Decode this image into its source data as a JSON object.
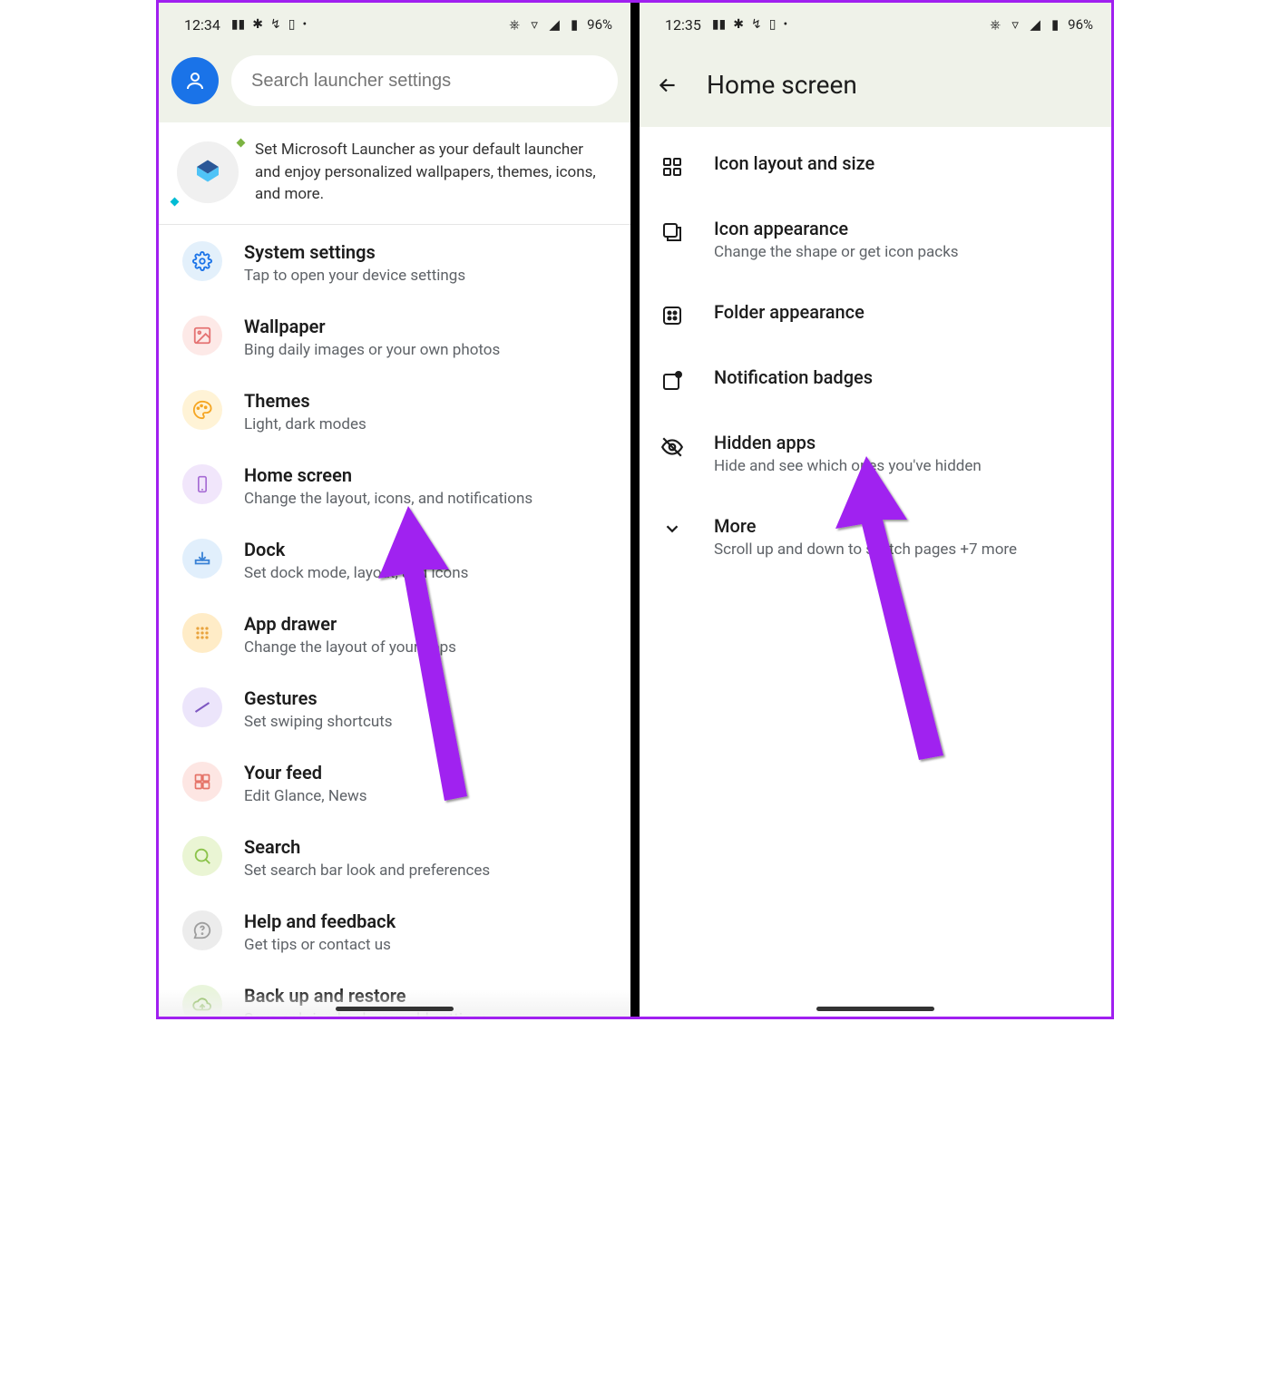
{
  "left": {
    "status": {
      "time": "12:34",
      "battery": "96%"
    },
    "search_placeholder": "Search launcher settings",
    "promo": "Set Microsoft Launcher as your default launcher and enjoy personalized wallpapers, themes, icons, and more.",
    "items": [
      {
        "icon": "gear",
        "bg": "#e3f0fb",
        "fg": "#1a73e8",
        "title": "System settings",
        "sub": "Tap to open your device settings"
      },
      {
        "icon": "image",
        "bg": "#fde9e7",
        "fg": "#e57373",
        "title": "Wallpaper",
        "sub": "Bing daily images or your own photos"
      },
      {
        "icon": "palette",
        "bg": "#fff3d6",
        "fg": "#f5a623",
        "title": "Themes",
        "sub": "Light, dark modes"
      },
      {
        "icon": "phone",
        "bg": "#f1e6fb",
        "fg": "#a66bd4",
        "title": "Home screen",
        "sub": "Change the layout, icons, and notifications"
      },
      {
        "icon": "dock",
        "bg": "#e1effc",
        "fg": "#3a82d6",
        "title": "Dock",
        "sub": "Set dock mode, layout, and icons"
      },
      {
        "icon": "grid",
        "bg": "#ffecc7",
        "fg": "#e8a33d",
        "title": "App drawer",
        "sub": "Change the layout of your apps"
      },
      {
        "icon": "gesture",
        "bg": "#ece5fb",
        "fg": "#7e57c2",
        "title": "Gestures",
        "sub": "Set swiping shortcuts"
      },
      {
        "icon": "feed",
        "bg": "#fde6e3",
        "fg": "#e57368",
        "title": "Your feed",
        "sub": "Edit Glance, News"
      },
      {
        "icon": "search",
        "bg": "#eaf5d4",
        "fg": "#8bc34a",
        "title": "Search",
        "sub": "Set search bar look and preferences"
      },
      {
        "icon": "help",
        "bg": "#ececec",
        "fg": "#9e9e9e",
        "title": "Help and feedback",
        "sub": "Get tips or contact us"
      },
      {
        "icon": "cloud",
        "bg": "#e9f5dc",
        "fg": "#7cb342",
        "title": "Back up and restore",
        "sub": "Save or bring back your old settings"
      }
    ]
  },
  "right": {
    "status": {
      "time": "12:35",
      "battery": "96%"
    },
    "page_title": "Home screen",
    "items": [
      {
        "icon": "layout",
        "title": "Icon layout and size",
        "sub": ""
      },
      {
        "icon": "shape",
        "title": "Icon appearance",
        "sub": "Change the shape or get icon packs"
      },
      {
        "icon": "folder",
        "title": "Folder appearance",
        "sub": ""
      },
      {
        "icon": "badge",
        "title": "Notification badges",
        "sub": ""
      },
      {
        "icon": "hidden",
        "title": "Hidden apps",
        "sub": "Hide and see which ones you've hidden"
      },
      {
        "icon": "more",
        "title": "More",
        "sub": "Scroll up and down to switch pages +7 more"
      }
    ]
  }
}
